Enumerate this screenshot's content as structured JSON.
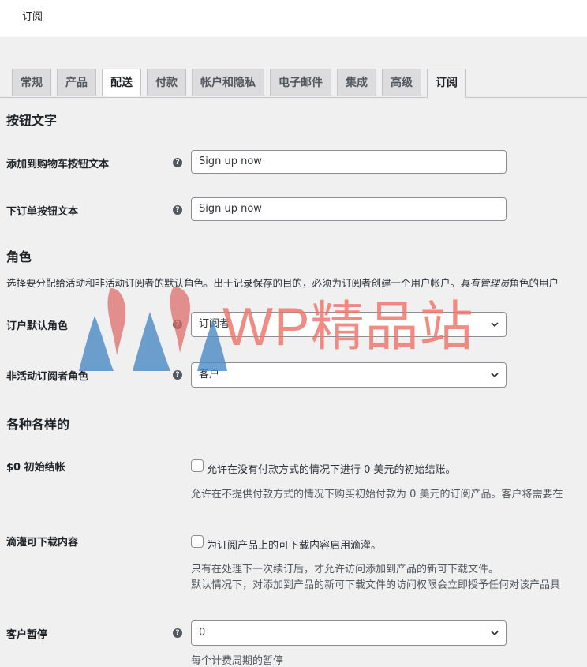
{
  "header": {
    "title": "订阅"
  },
  "tabs": [
    {
      "label": "常规"
    },
    {
      "label": "产品"
    },
    {
      "label": "配送"
    },
    {
      "label": "付款"
    },
    {
      "label": "帐户和隐私"
    },
    {
      "label": "电子邮件"
    },
    {
      "label": "集成"
    },
    {
      "label": "高级"
    },
    {
      "label": "订阅"
    }
  ],
  "sections": {
    "button_text": {
      "heading": "按钮文字",
      "add_to_cart_label": "添加到购物车按钮文本",
      "add_to_cart_value": "Sign up now",
      "place_order_label": "下订单按钮文本",
      "place_order_value": "Sign up now"
    },
    "roles": {
      "heading": "角色",
      "description": "选择要分配给活动和非活动订阅者的默认角色。出于记录保存的目的，必须为订阅者创建一个用户帐户。",
      "description_em": "具有管理员",
      "description_tail": "角色的用户",
      "default_role_label": "订户默认角色",
      "default_role_value": "订阅者",
      "inactive_role_label": "非活动订阅者角色",
      "inactive_role_value": "客户"
    },
    "misc": {
      "heading": "各种各样的",
      "zero_checkout_label": "$0 初始结帐",
      "zero_checkout_checkbox": "允许在没有付款方式的情况下进行 0 美元的初始结账。",
      "zero_checkout_desc": "允许在不提供付款方式的情况下购买初始付款为 0 美元的订阅产品。客户将需要在",
      "drip_label": "滴灌可下载内容",
      "drip_checkbox": "为订阅产品上的可下载内容启用滴灌。",
      "drip_desc_1": "只有在处理下一次续订后，才允许访问添加到产品的新可下载文件。",
      "drip_desc_2": "默认情况下，对添加到产品的新可下载文件的访问权限会立即授予任何对该产品具",
      "suspension_label": "客户暂停",
      "suspension_value": "0",
      "suspension_desc": "每个计费周期的暂停"
    }
  },
  "watermark": {
    "text": "WP精品站"
  },
  "colors": {
    "background": "#f0f0f1",
    "tab_inactive": "#dcdcde",
    "border": "#c3c4c7",
    "watermark_red": "#e8736a",
    "watermark_blue": "#4a8ac4"
  }
}
